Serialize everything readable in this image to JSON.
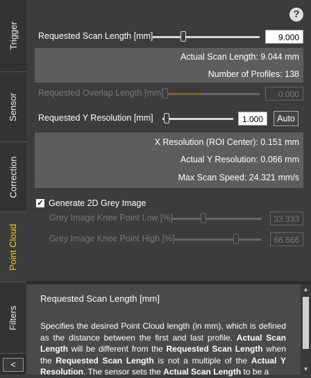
{
  "sidebar": {
    "tabs": [
      {
        "label": "Trigger"
      },
      {
        "label": "Sensor"
      },
      {
        "label": "Correction"
      },
      {
        "label": "Point Cloud"
      },
      {
        "label": "Filters"
      }
    ],
    "active_tab": "Point Cloud",
    "collapse_label": "<"
  },
  "main": {
    "help_icon": "?",
    "scan_length": {
      "label": "Requested Scan Length [mm]",
      "value": "9.000",
      "slider_level": 0.29
    },
    "scan_info": {
      "actual_scan_length": "Actual Scan Length: 9.044 mm",
      "profiles": "Number of Profiles: 138"
    },
    "overlap": {
      "label": "Requested Overlap Length [mm]",
      "value": "0.000",
      "slider_level": 0.0
    },
    "y_resolution": {
      "label": "Requested Y Resolution [mm]",
      "value": "1.000",
      "auto_label": "Auto",
      "slider_level": 0.05
    },
    "resolution_info": {
      "x_resolution": "X Resolution (ROI Center): 0.151 mm",
      "actual_y": "Actual Y Resolution: 0.066 mm",
      "max_speed": "Max Scan Speed: 24.321 mm/s"
    },
    "grey_image": {
      "checkbox_label": "Generate 2D Grey Image",
      "checked": true
    },
    "knee_low": {
      "label": "Grey Image Knee Point Low [%]",
      "value": "33.333",
      "slider_level": 0.33
    },
    "knee_high": {
      "label": "Grey Image Knee Point High [%]",
      "value": "66.666",
      "slider_level": 0.67
    }
  },
  "help": {
    "title": "Requested Scan Length [mm]",
    "body_segments": [
      {
        "text": "Specifies the desired Point Cloud length (in mm), which is defined as the distance between the first and last profile. ",
        "bold": false
      },
      {
        "text": "Actual Scan Length",
        "bold": true
      },
      {
        "text": " will be different from the ",
        "bold": false
      },
      {
        "text": "Requested Scan Length",
        "bold": true
      },
      {
        "text": " when the ",
        "bold": false
      },
      {
        "text": "Requested Scan Length",
        "bold": true
      },
      {
        "text": " is not a multiple of the ",
        "bold": false
      },
      {
        "text": "Actual Y Resolution",
        "bold": true
      },
      {
        "text": ". The sensor sets the ",
        "bold": false
      },
      {
        "text": "Actual Scan Length",
        "bold": true
      },
      {
        "text": " to be a",
        "bold": false
      }
    ]
  },
  "colors": {
    "active_tab": "#f0d020",
    "panel_bg": "#3c3c3c",
    "info_bg": "#5d5d5d",
    "help_bg": "#4a4a4a"
  }
}
